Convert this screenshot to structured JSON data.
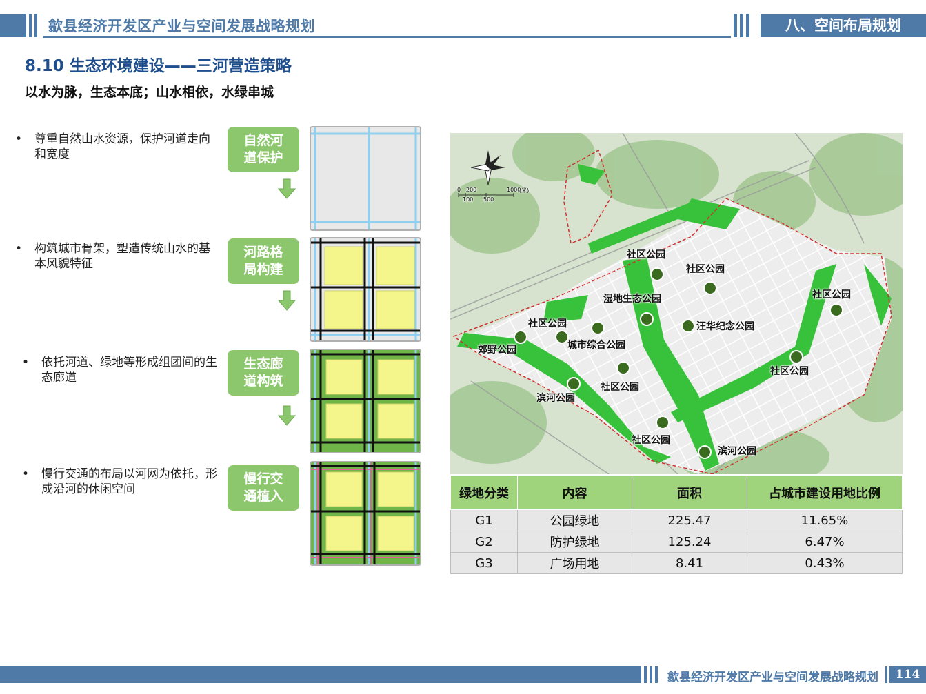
{
  "header": {
    "doc_title": "歙县经济开发区产业与空间发展战略规划",
    "chapter": "八、空间布局规划"
  },
  "section": {
    "title": "8.10 生态环境建设——三河营造策略",
    "subtitle": "以水为脉，生态本底；山水相依，水绿串城"
  },
  "steps": [
    {
      "bullet": "•",
      "text": "尊重自然山水资源，保护河道走向和宽度",
      "tag": "自然河道保护"
    },
    {
      "bullet": "•",
      "text": "构筑城市骨架，塑造传统山水的基本风貌特征",
      "tag": "河路格局构建"
    },
    {
      "bullet": "•",
      "text": "依托河道、绿地等形成组团间的生态廊道",
      "tag": "生态廊道构筑"
    },
    {
      "bullet": "•",
      "text": "慢行交通的布局以河网为依托，形成沿河的休闲空间",
      "tag": "慢行交通植入"
    }
  ],
  "map": {
    "scale_labels": [
      "0",
      "200",
      "1000",
      "(米)",
      "100",
      "500"
    ],
    "parks": [
      "社区公园",
      "社区公园",
      "湿地生态公园",
      "社区公园",
      "社区公园",
      "汪华纪念公园",
      "郊野公园",
      "城市综合公园",
      "社区公园",
      "社区公园",
      "滨河公园",
      "社区公园",
      "滨河公园"
    ]
  },
  "table": {
    "headers": [
      "绿地分类",
      "内容",
      "面积",
      "占城市建设用地比例"
    ],
    "rows": [
      [
        "G1",
        "公园绿地",
        "225.47",
        "11.65%"
      ],
      [
        "G2",
        "防护绿地",
        "125.24",
        "6.47%"
      ],
      [
        "G3",
        "广场用地",
        "8.41",
        "0.43%"
      ]
    ]
  },
  "footer": {
    "doc_title": "歙县经济开发区产业与空间发展战略规划",
    "page": "114"
  },
  "colors": {
    "brand_blue": "#4f7aa8",
    "title_blue": "#1f4e8c",
    "green_tag": "#8cc66d",
    "table_header": "#9fd37c"
  }
}
